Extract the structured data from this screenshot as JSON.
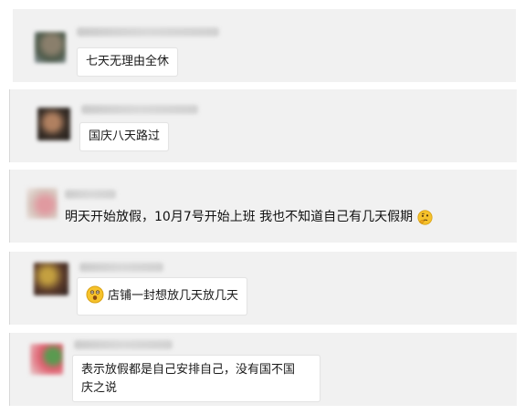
{
  "messages": [
    {
      "text": "七天无理由全休"
    },
    {
      "text": "国庆八天路过"
    },
    {
      "text": "明天开始放假，10月7号开始上班 我也不知道自己有几天假期",
      "trailing_emoji": "thinking-face-icon"
    },
    {
      "text": "店铺一封想放几天放几天",
      "leading_emoji": "grimacing-face-icon"
    },
    {
      "text_line1": "表示放假都是自己安排自己，没有国不国",
      "text_line2": "庆之说"
    }
  ],
  "colors": {
    "card_bg": "#f1f1f1",
    "bubble_bg": "#ffffff",
    "emoji_yellow": "#f6c22b"
  }
}
